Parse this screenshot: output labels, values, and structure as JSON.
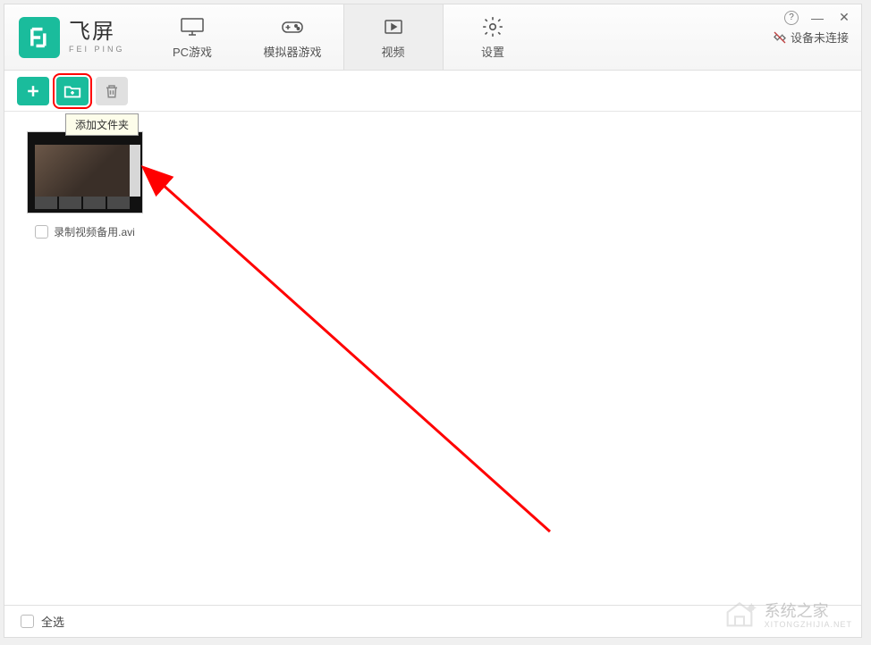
{
  "app": {
    "name_cn": "飞屏",
    "name_en": "FEI PING"
  },
  "tabs": {
    "pc_games": "PC游戏",
    "emulator_games": "模拟器游戏",
    "video": "视频",
    "settings": "设置"
  },
  "status": {
    "device": "设备未连接"
  },
  "toolbar": {
    "tooltip_add_folder": "添加文件夹"
  },
  "content": {
    "items": [
      {
        "filename": "录制视频备用.avi"
      }
    ]
  },
  "footer": {
    "select_all": "全选"
  },
  "watermark": {
    "title": "系统之家",
    "sub": "XITONGZHIJIA.NET"
  }
}
